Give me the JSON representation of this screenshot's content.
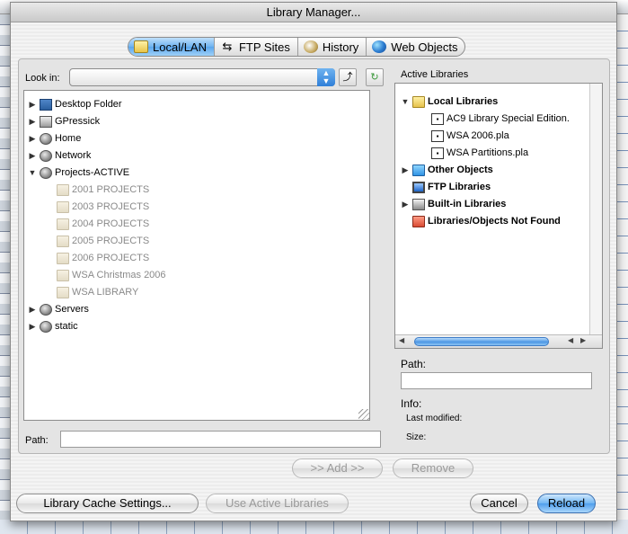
{
  "dialog": {
    "title": "Library Manager..."
  },
  "tabs": [
    {
      "label": "Local/LAN",
      "icon": "folder-icon",
      "active": true
    },
    {
      "label": "FTP Sites",
      "icon": "ftp-icon",
      "active": false
    },
    {
      "label": "History",
      "icon": "history-icon",
      "active": false
    },
    {
      "label": "Web Objects",
      "icon": "globe-icon",
      "active": false
    }
  ],
  "left": {
    "look_in_label": "Look in:",
    "look_in_value": "",
    "tree": [
      {
        "label": "Desktop Folder",
        "icon": "desktop-icon",
        "expanded": false,
        "enabled": true
      },
      {
        "label": "GPressick",
        "icon": "drive-icon",
        "expanded": false,
        "enabled": true
      },
      {
        "label": "Home",
        "icon": "network-globe-icon",
        "expanded": false,
        "enabled": true
      },
      {
        "label": "Network",
        "icon": "network-globe-icon",
        "expanded": false,
        "enabled": true
      },
      {
        "label": "Projects-ACTIVE",
        "icon": "network-globe-icon",
        "expanded": true,
        "enabled": true
      },
      {
        "label": "2001 PROJECTS",
        "icon": "folder-icon",
        "enabled": false
      },
      {
        "label": "2003 PROJECTS",
        "icon": "folder-icon",
        "enabled": false
      },
      {
        "label": "2004 PROJECTS",
        "icon": "folder-icon",
        "enabled": false
      },
      {
        "label": "2005 PROJECTS",
        "icon": "folder-icon",
        "enabled": false
      },
      {
        "label": "2006 PROJECTS",
        "icon": "folder-icon",
        "enabled": false
      },
      {
        "label": "WSA Christmas 2006",
        "icon": "folder-icon",
        "enabled": false
      },
      {
        "label": "WSA LIBRARY",
        "icon": "folder-icon",
        "enabled": false
      },
      {
        "label": "Servers",
        "icon": "network-globe-icon",
        "expanded": false,
        "enabled": true
      },
      {
        "label": "static",
        "icon": "network-globe-icon",
        "expanded": false,
        "enabled": true
      }
    ],
    "path_label": "Path:",
    "path_value": ""
  },
  "right": {
    "title": "Active Libraries",
    "tree": [
      {
        "label": "Local Libraries",
        "bold": true,
        "expanded": true
      },
      {
        "label": "AC9 Library Special Edition.",
        "bold": false
      },
      {
        "label": "WSA 2006.pla",
        "bold": false
      },
      {
        "label": "WSA Partitions.pla",
        "bold": false
      },
      {
        "label": "Other Objects",
        "bold": true,
        "expanded": false
      },
      {
        "label": "FTP Libraries",
        "bold": true
      },
      {
        "label": "Built-in Libraries",
        "bold": true,
        "expanded": false
      },
      {
        "label": "Libraries/Objects Not Found",
        "bold": true
      }
    ],
    "path_label": "Path:",
    "path_value": "",
    "info_label": "Info:",
    "last_modified_label": "Last modified:",
    "size_label": "Size:"
  },
  "buttons": {
    "add": ">> Add >>",
    "remove": "Remove",
    "cache_settings": "Library Cache Settings...",
    "use_active": "Use Active Libraries",
    "cancel": "Cancel",
    "reload": "Reload"
  },
  "colors": {
    "accent": "#5aa6ed",
    "disabled_text": "#9a9a9a"
  }
}
